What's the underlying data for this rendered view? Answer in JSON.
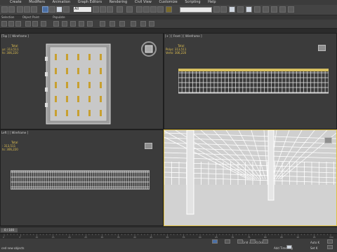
{
  "menu": [
    "Create",
    "Modifiers",
    "Animation",
    "Graph Editors",
    "Rendering",
    "Civil View",
    "Customize",
    "Scripting",
    "Help"
  ],
  "toolbar": {
    "selection_filter": "All"
  },
  "ribbon": {
    "tabs": [
      "Selection",
      "Object Paint",
      "Populate"
    ]
  },
  "viewports": {
    "top": {
      "label": "[Top ] [ Wireframe ]",
      "stats": {
        "total": "Total",
        "polys_label": "ys:",
        "polys": "313,511",
        "verts_label": "ts:",
        "verts": "306,220"
      }
    },
    "front": {
      "label": "[+ ] [ Front ] [ Wireframe ]",
      "stats": {
        "total": "Total",
        "polys_label": "Polys:",
        "polys": "313,511",
        "verts_label": "Verts:",
        "verts": "306,220"
      }
    },
    "left": {
      "label": "Left ] [ Wireframe ]",
      "stats": {
        "total": "Total",
        "polys_label": ":",
        "polys": "313,511",
        "verts_label": "ts:",
        "verts": "306,220"
      }
    },
    "perspective": {
      "label": ""
    }
  },
  "timeline": {
    "frame_text": "0 / 100",
    "ticks": [
      "0",
      "5",
      "10",
      "15",
      "20",
      "25",
      "30",
      "35",
      "40",
      "45",
      "50",
      "55",
      "60",
      "65",
      "70",
      "75",
      "80",
      "85",
      "90",
      "95",
      "100"
    ]
  },
  "status": {
    "left_text": "ced new objects",
    "grid_text": "Grid = 100,0cm",
    "add_time_tag": "Add Time Tag",
    "auto_key": "Auto K",
    "set_key": "Set K"
  }
}
